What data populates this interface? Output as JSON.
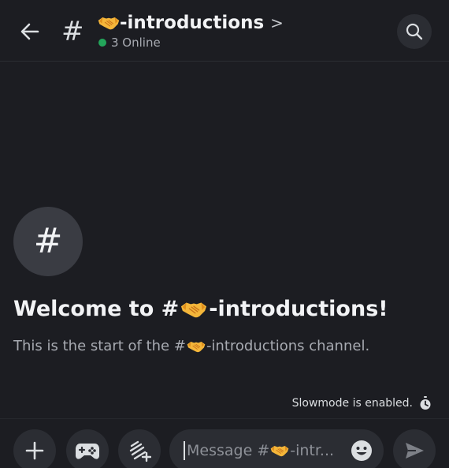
{
  "header": {
    "channel_name": "-introductions",
    "chevron": ">",
    "online_text": "3 Online",
    "hash_glyph": "#",
    "back_icon": "arrow-left-icon",
    "search_icon": "search-icon"
  },
  "welcome": {
    "avatar_glyph": "#",
    "title_prefix": "Welcome to #",
    "title_suffix": "-introductions!",
    "subtitle_prefix": "This is the start of the #",
    "subtitle_suffix": "-introductions channel."
  },
  "slowmode": {
    "text": "Slowmode is enabled.",
    "icon": "timer-icon"
  },
  "composer": {
    "placeholder_prefix": "Message #",
    "placeholder_suffix": "-intr...",
    "buttons": [
      "plus-icon",
      "gamepad-icon",
      "apps-icon",
      "emoji-icon",
      "send-icon"
    ]
  },
  "colors": {
    "background": "#1c1d22",
    "surface": "#2b2d33",
    "online": "#23a55a",
    "handshake": "#f4b63a"
  }
}
